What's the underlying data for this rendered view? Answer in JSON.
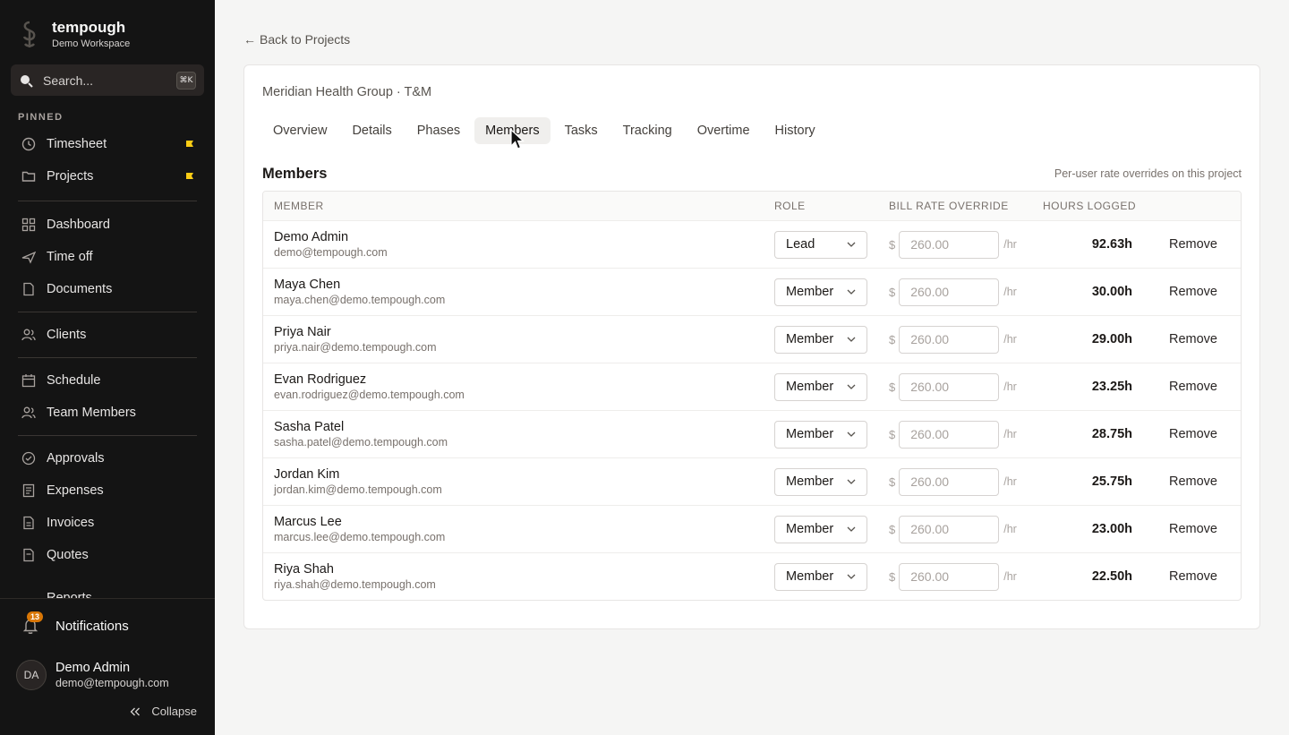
{
  "sidebar": {
    "brand_name": "tempough",
    "workspace": "Demo Workspace",
    "search_placeholder": "Search...",
    "search_shortcut": "⌘K",
    "pinned_label": "PINNED",
    "pinned": [
      {
        "label": "Timesheet",
        "icon": "clock-icon"
      },
      {
        "label": "Projects",
        "icon": "folder-icon"
      }
    ],
    "groups": [
      [
        {
          "label": "Dashboard",
          "icon": "grid-icon"
        },
        {
          "label": "Time off",
          "icon": "plane-icon"
        },
        {
          "label": "Documents",
          "icon": "document-icon"
        }
      ],
      [
        {
          "label": "Clients",
          "icon": "users-icon"
        }
      ],
      [
        {
          "label": "Schedule",
          "icon": "calendar-icon"
        },
        {
          "label": "Team Members",
          "icon": "users-icon"
        }
      ],
      [
        {
          "label": "Approvals",
          "icon": "check-circle-icon"
        },
        {
          "label": "Expenses",
          "icon": "receipt-icon"
        },
        {
          "label": "Invoices",
          "icon": "invoice-icon"
        },
        {
          "label": "Quotes",
          "icon": "quote-icon"
        }
      ]
    ],
    "cut_item": "Reports",
    "notifications_label": "Notifications",
    "notifications_count": "13",
    "user": {
      "initials": "DA",
      "name": "Demo Admin",
      "email": "demo@tempough.com"
    },
    "collapse_label": "Collapse"
  },
  "main": {
    "back_label": "Back to Projects",
    "project_title": "Meridian Health Group · T&M",
    "tabs": [
      "Overview",
      "Details",
      "Phases",
      "Members",
      "Tasks",
      "Tracking",
      "Overtime",
      "History"
    ],
    "active_tab": "Members",
    "section_title": "Members",
    "section_note": "Per-user rate overrides on this project",
    "columns": {
      "member": "MEMBER",
      "role": "ROLE",
      "rate": "BILL RATE OVERRIDE",
      "hours": "HOURS LOGGED"
    },
    "currency": "$",
    "rate_unit": "/hr",
    "remove_label": "Remove",
    "members": [
      {
        "name": "Demo Admin",
        "email": "demo@tempough.com",
        "role": "Lead",
        "rate_placeholder": "260.00",
        "hours": "92.63h"
      },
      {
        "name": "Maya Chen",
        "email": "maya.chen@demo.tempough.com",
        "role": "Member",
        "rate_placeholder": "260.00",
        "hours": "30.00h"
      },
      {
        "name": "Priya Nair",
        "email": "priya.nair@demo.tempough.com",
        "role": "Member",
        "rate_placeholder": "260.00",
        "hours": "29.00h"
      },
      {
        "name": "Evan Rodriguez",
        "email": "evan.rodriguez@demo.tempough.com",
        "role": "Member",
        "rate_placeholder": "260.00",
        "hours": "23.25h"
      },
      {
        "name": "Sasha Patel",
        "email": "sasha.patel@demo.tempough.com",
        "role": "Member",
        "rate_placeholder": "260.00",
        "hours": "28.75h"
      },
      {
        "name": "Jordan Kim",
        "email": "jordan.kim@demo.tempough.com",
        "role": "Member",
        "rate_placeholder": "260.00",
        "hours": "25.75h"
      },
      {
        "name": "Marcus Lee",
        "email": "marcus.lee@demo.tempough.com",
        "role": "Member",
        "rate_placeholder": "260.00",
        "hours": "23.00h"
      },
      {
        "name": "Riya Shah",
        "email": "riya.shah@demo.tempough.com",
        "role": "Member",
        "rate_placeholder": "260.00",
        "hours": "22.50h"
      }
    ]
  },
  "colors": {
    "sidebar_bg": "#141414",
    "page_bg": "#f5f5f4",
    "pin_accent": "#facc15",
    "badge": "#d97706"
  }
}
